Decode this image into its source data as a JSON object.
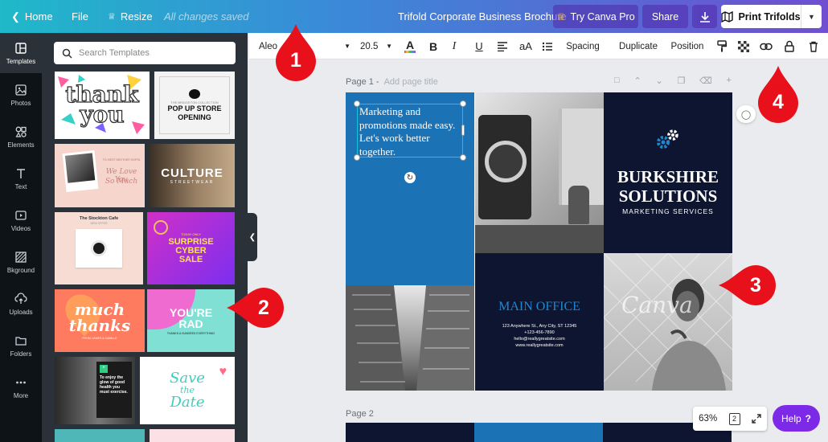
{
  "topbar": {
    "home_label": "Home",
    "file_label": "File",
    "resize_label": "Resize",
    "saved_status": "All changes saved",
    "doc_title": "Trifold Corporate Business Brochure",
    "try_pro_label": "Try Canva Pro",
    "share_label": "Share",
    "print_label": "Print Trifolds"
  },
  "siderail": {
    "items": [
      {
        "label": "Templates",
        "icon": "templates-icon"
      },
      {
        "label": "Photos",
        "icon": "photos-icon"
      },
      {
        "label": "Elements",
        "icon": "elements-icon"
      },
      {
        "label": "Text",
        "icon": "text-icon"
      },
      {
        "label": "Videos",
        "icon": "videos-icon"
      },
      {
        "label": "Bkground",
        "icon": "background-icon"
      },
      {
        "label": "Uploads",
        "icon": "uploads-icon"
      },
      {
        "label": "Folders",
        "icon": "folders-icon"
      },
      {
        "label": "More",
        "icon": "more-icon"
      }
    ]
  },
  "templates_panel": {
    "search_placeholder": "Search Templates",
    "tiles": {
      "thankyou": {
        "line1": "thank",
        "line2": "you"
      },
      "popup": {
        "small": "THE BRIDGETON COLLECTION",
        "line1": "POP UP STORE",
        "line2": "OPENING"
      },
      "loveyou": {
        "small": "TO: BEST BROTHER SORTA",
        "line1": "We Love You",
        "line2": "So Much"
      },
      "culture": {
        "line1": "CULTURE",
        "line2": "STREETWEAR"
      },
      "cafe": {
        "line1": "The Stockton Cafe",
        "line2": "NEW OFFER"
      },
      "cyber": {
        "small": "TODAY ONLY",
        "line1": "SURPRISE",
        "line2": "CYBER",
        "line3": "SALE"
      },
      "muchthanks": {
        "line1": "much",
        "line2": "thanks",
        "small": "FROM: JAMES & CAMILLE"
      },
      "rad": {
        "line1": "YOU'RE",
        "line2": "RAD",
        "small": "THANKS A HUNDRED EVERYTHING"
      },
      "fitness": {
        "text": "To enjoy the glow of good health you must exercise."
      },
      "savedate": {
        "line1": "Save",
        "line2": "the",
        "line3": "Date"
      }
    }
  },
  "toolbar": {
    "font_name": "Aleo",
    "font_size": "20.5",
    "spacing_label": "Spacing",
    "duplicate_label": "Duplicate",
    "position_label": "Position",
    "bold": "B",
    "italic": "I",
    "underline": "U",
    "case": "aA",
    "color_letter": "A"
  },
  "canvas": {
    "page1_label": "Page 1 -",
    "page1_title_placeholder": "Add page title",
    "page2_label": "Page 2",
    "selected_text": "Marketing and promotions made easy. Let's work better together.",
    "brand_name_1": "BURKSHIRE",
    "brand_name_2": "SOLUTIONS",
    "brand_tagline": "MARKETING SERVICES",
    "office_title": "MAIN OFFICE",
    "office_address": "123 Anywhere St., Any City, ST 12345",
    "office_phone": "+123-456-7890",
    "office_email": "hello@reallygreatsite.com",
    "office_web": "www.reallygreatsite.com",
    "watermark": "Canva"
  },
  "bottom": {
    "zoom": "63%",
    "pages_count": "2",
    "help_label": "Help",
    "help_mark": "?"
  },
  "callouts": [
    "1",
    "2",
    "3",
    "4"
  ],
  "colors": {
    "callout_red": "#e8101a",
    "brochure_blue": "#1b72b5",
    "brochure_navy": "#0e1530",
    "help_purple": "#7d2ae8"
  }
}
